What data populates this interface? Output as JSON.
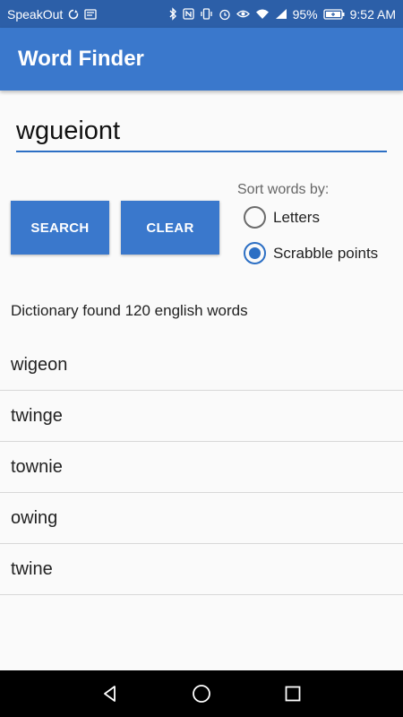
{
  "status_bar": {
    "carrier": "SpeakOut",
    "battery": "95%",
    "time": "9:52 AM"
  },
  "app_bar": {
    "title": "Word Finder"
  },
  "search": {
    "value": "wgueiont"
  },
  "buttons": {
    "search_label": "SEARCH",
    "clear_label": "CLEAR"
  },
  "sort": {
    "label": "Sort words by:",
    "options": [
      {
        "label": "Letters",
        "selected": false
      },
      {
        "label": "Scrabble points",
        "selected": true
      }
    ]
  },
  "results": {
    "summary": "Dictionary found 120 english words",
    "words": [
      "wigeon",
      "twinge",
      "townie",
      "owing",
      "twine"
    ]
  },
  "colors": {
    "accent": "#3a78cc",
    "status_bar": "#2c5fa8"
  }
}
